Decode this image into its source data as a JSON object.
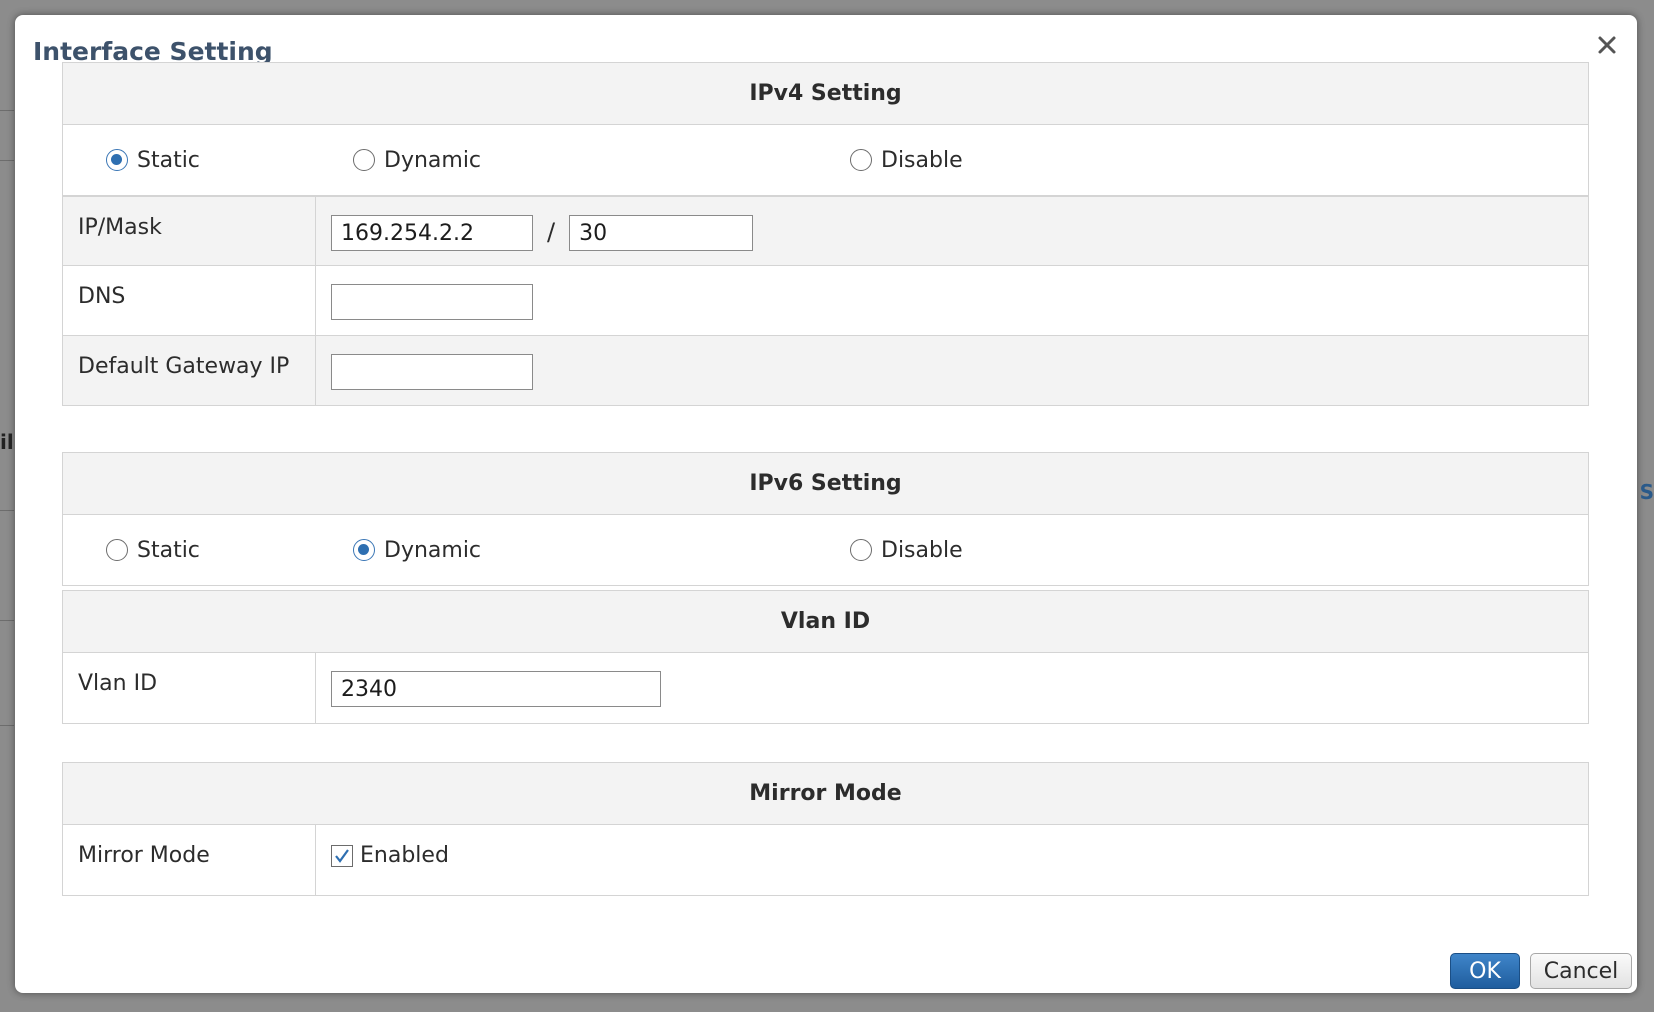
{
  "dialog": {
    "title": "Interface Setting",
    "close_icon": "close-icon"
  },
  "ipv4": {
    "header": "IPv4 Setting",
    "mode_options": [
      {
        "label": "Static",
        "checked": true
      },
      {
        "label": "Dynamic",
        "checked": false
      },
      {
        "label": "Disable",
        "checked": false
      }
    ],
    "ip_mask_label": "IP/Mask",
    "ip_value": "169.254.2.2",
    "mask_separator": "/",
    "mask_value": "30",
    "dns_label": "DNS",
    "dns_value": "",
    "gateway_label": "Default Gateway IP",
    "gateway_value": ""
  },
  "ipv6": {
    "header": "IPv6 Setting",
    "mode_options": [
      {
        "label": "Static",
        "checked": false
      },
      {
        "label": "Dynamic",
        "checked": true
      },
      {
        "label": "Disable",
        "checked": false
      }
    ]
  },
  "vlan": {
    "header": "Vlan ID",
    "label": "Vlan ID",
    "value": "2340"
  },
  "mirror": {
    "header": "Mirror Mode",
    "label": "Mirror Mode",
    "checkbox_label": "Enabled",
    "checked": true
  },
  "buttons": {
    "ok_label": "OK",
    "cancel_label": "Cancel"
  },
  "colors": {
    "title": "#3d526b",
    "accent": "#2e6fb1",
    "header_bg": "#f3f3f3",
    "overlay": "#8c8c8c"
  }
}
